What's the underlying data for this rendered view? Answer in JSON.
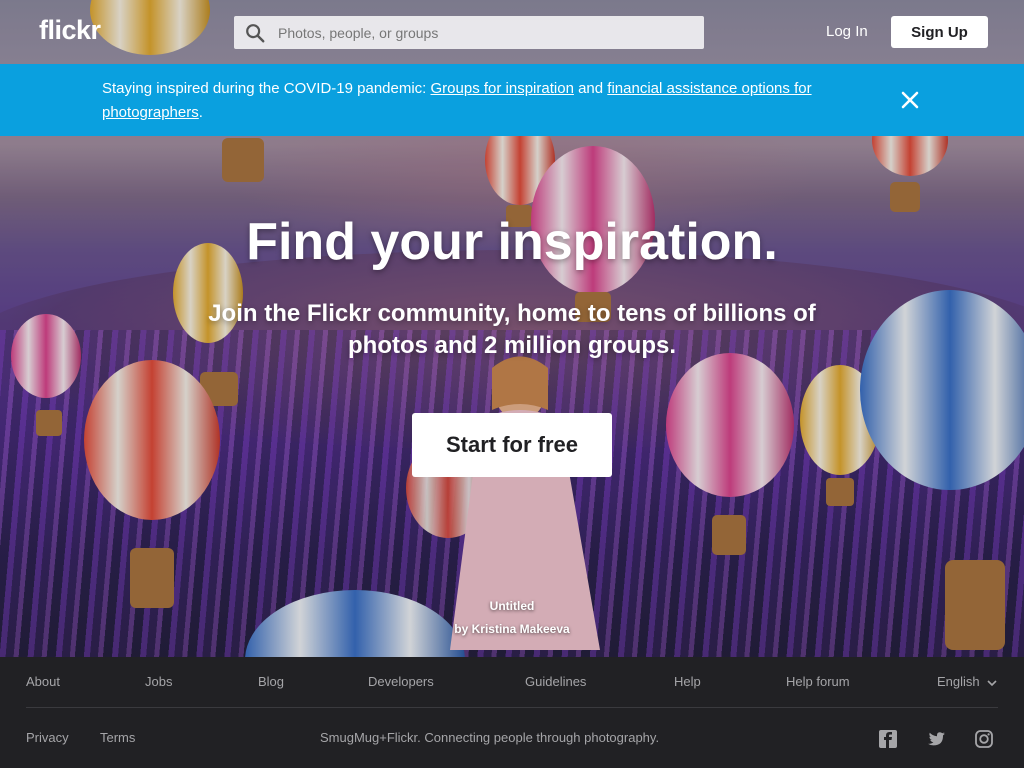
{
  "brand": {
    "logo": "flickr"
  },
  "header": {
    "search_placeholder": "Photos, people, or groups",
    "login_label": "Log In",
    "signup_label": "Sign Up"
  },
  "banner": {
    "prefix": "Staying inspired during the COVID-19 pandemic: ",
    "link1": "Groups for inspiration",
    "middle": " and ",
    "link2": "financial assistance options for photographers",
    "suffix": "."
  },
  "hero": {
    "headline": "Find your inspiration.",
    "subline": "Join the Flickr community, home to tens of billions of photos and 2 million groups.",
    "cta_label": "Start for free",
    "photo_title": "Untitled",
    "photo_author": "by Kristina Makeeva"
  },
  "footer": {
    "links": [
      "About",
      "Jobs",
      "Blog",
      "Developers",
      "Guidelines",
      "Help",
      "Help forum"
    ],
    "language": "English",
    "bottom_links": [
      "Privacy",
      "Terms"
    ],
    "tagline": "SmugMug+Flickr. Connecting people through photography.",
    "social_icons": [
      "facebook-icon",
      "twitter-icon",
      "instagram-icon"
    ]
  },
  "colors": {
    "banner": "#0aa0df",
    "footer_bg": "#212124",
    "footer_text": "#a5a5a8"
  }
}
